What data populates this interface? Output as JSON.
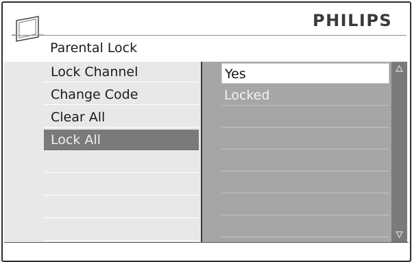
{
  "brand": "PHILIPS",
  "page_title": "Parental Lock",
  "icons": {
    "header": "tv-icon",
    "scroll_up": "scroll-up-arrow-icon",
    "scroll_down": "scroll-down-arrow-icon"
  },
  "menu": {
    "items": [
      {
        "label": "Lock Channel",
        "selected": false
      },
      {
        "label": "Change Code",
        "selected": false
      },
      {
        "label": "Clear All",
        "selected": false
      },
      {
        "label": "Lock All",
        "selected": true
      },
      {
        "label": ""
      },
      {
        "label": ""
      },
      {
        "label": ""
      },
      {
        "label": ""
      }
    ]
  },
  "options": {
    "items": [
      {
        "label": "Yes",
        "highlighted": true
      },
      {
        "label": "Locked",
        "highlighted": false
      },
      {
        "label": ""
      },
      {
        "label": ""
      },
      {
        "label": ""
      },
      {
        "label": ""
      },
      {
        "label": ""
      },
      {
        "label": ""
      }
    ]
  },
  "colors": {
    "selected_row": "#7a7a7a",
    "left_panel": "#e8e8e8",
    "right_panel": "#a6a6a6",
    "scrollbar": "#7a7a7a"
  }
}
